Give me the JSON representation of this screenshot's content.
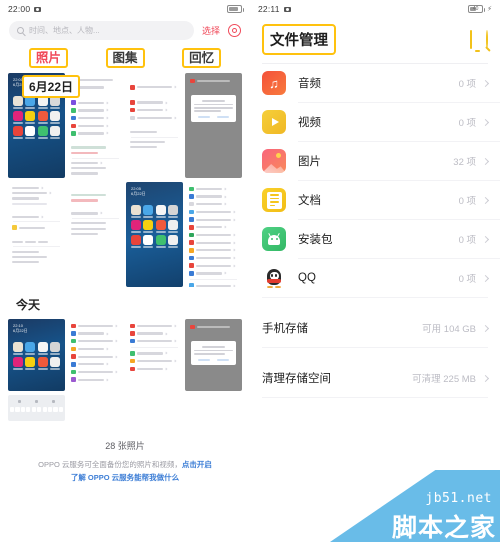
{
  "left_phone": {
    "status_bar": {
      "time": "22:00",
      "camera_icon": "camera-icon",
      "battery": ""
    },
    "search": {
      "placeholder": "时间、地点、人物...",
      "icon": "search-icon"
    },
    "select_label": "选择",
    "camera_button_icon": "camera-shutter-icon",
    "tabs": [
      {
        "label": "照片",
        "active": true,
        "highlighted": true
      },
      {
        "label": "图集",
        "active": false,
        "highlighted": true
      },
      {
        "label": "回忆",
        "active": false,
        "highlighted": true
      }
    ],
    "date_chip": "6月22日",
    "today_heading": "今天",
    "footer": {
      "count": "28 张照片",
      "cloud_line1_a": "OPPO 云服务可全面备份您的照片和视频，",
      "cloud_line1_link": "点击开启",
      "cloud_line2_link": "了解 OPPO 云服务能帮我做什么"
    }
  },
  "right_phone": {
    "status_bar": {
      "time": "22:11",
      "camera_icon": "camera-icon",
      "battery": "40",
      "charging": "⚡"
    },
    "header": {
      "title": "文件管理",
      "cast_icon": "monitor-cast-icon",
      "search_icon": "search-icon"
    },
    "categories": [
      {
        "icon": "audio-icon",
        "label": "音频",
        "meta": "0 项",
        "color": "#f4513a"
      },
      {
        "icon": "video-icon",
        "label": "视频",
        "meta": "0 项",
        "color": "#f5c93a"
      },
      {
        "icon": "picture-icon",
        "label": "图片",
        "meta": "32 项",
        "color": "#f56a7a"
      },
      {
        "icon": "document-icon",
        "label": "文档",
        "meta": "0 项",
        "color": "#f6c81f"
      },
      {
        "icon": "apk-icon",
        "label": "安装包",
        "meta": "0 项",
        "color": "#3fbf6f"
      },
      {
        "icon": "qq-icon",
        "label": "QQ",
        "meta": "0 项",
        "color": "#ffffff"
      }
    ],
    "storage_rows": [
      {
        "label": "手机存储",
        "meta": "可用 104 GB"
      },
      {
        "label": "清理存储空间",
        "meta": "可清理 225 MB"
      }
    ]
  },
  "watermark": {
    "url": "jb51.net",
    "brand": "脚本之家"
  },
  "colors": {
    "accent_red": "#f04a5a",
    "highlight_yellow": "#ffc20e",
    "link_blue": "#3f7fd6",
    "watermark_blue": "#69bce8"
  }
}
